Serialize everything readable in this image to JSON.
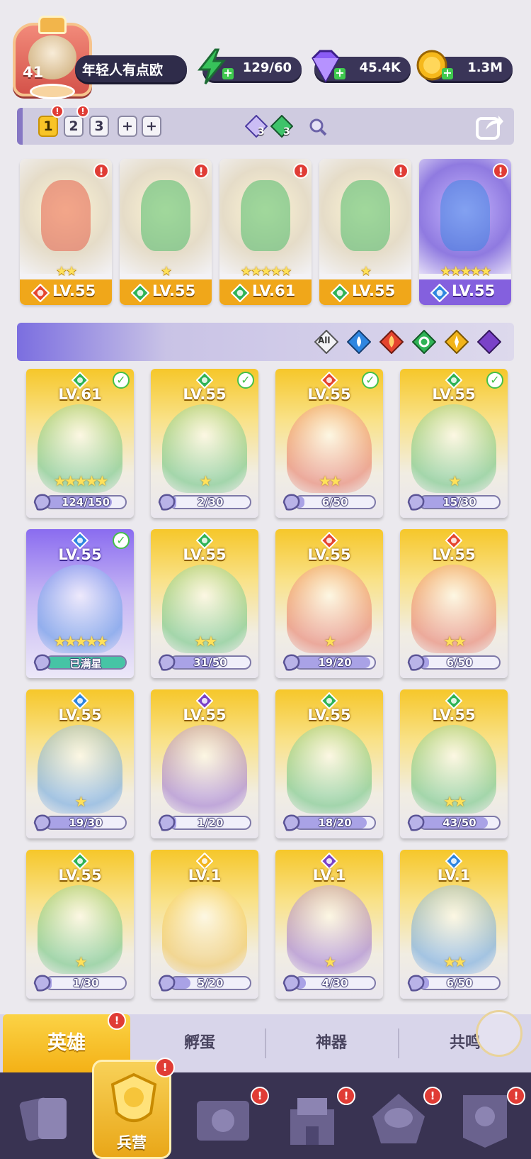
{
  "player": {
    "level": "41",
    "name": "年轻人有点欧",
    "avatar_icon": "player-avatar"
  },
  "resources": [
    {
      "name": "energy",
      "icon": "lightning-icon",
      "value": "129/60",
      "color": "#37c35a"
    },
    {
      "name": "gems",
      "icon": "diamond-icon",
      "value": "45.4K",
      "color": "#8b5cf6"
    },
    {
      "name": "gold",
      "icon": "coin-icon",
      "value": "1.3M",
      "color": "#f6b81b"
    }
  ],
  "teams": {
    "tabs": [
      "1",
      "2",
      "3",
      "+",
      "+"
    ],
    "active": "1",
    "runes": [
      {
        "icon": "purple-rune-icon",
        "count": "3"
      },
      {
        "icon": "green-rune-icon",
        "count": "3"
      }
    ],
    "search_icon": "magnifier-icon",
    "share_icon": "share-icon"
  },
  "lineup": [
    {
      "element": "fire",
      "level": "LV.55",
      "stars": "★★",
      "badge": "!",
      "theme": "gold"
    },
    {
      "element": "wind",
      "level": "LV.55",
      "stars": "★",
      "badge": "!",
      "theme": "gold"
    },
    {
      "element": "wind",
      "level": "LV.61",
      "stars": "★★★★★",
      "badge": "!",
      "theme": "gold"
    },
    {
      "element": "wind",
      "level": "LV.55",
      "stars": "★",
      "badge": "!",
      "theme": "gold"
    },
    {
      "element": "water",
      "level": "LV.55",
      "stars": "★★★★★",
      "badge": "!",
      "theme": "purple"
    }
  ],
  "filters": [
    "All",
    "water",
    "fire",
    "wind",
    "light",
    "dark"
  ],
  "filter_all_label": "All",
  "heroes": [
    {
      "element": "wind",
      "level": "LV.61",
      "stars": "★★★★★",
      "progress": "124/150",
      "fraction": 0.83,
      "ready": true,
      "theme": "gold"
    },
    {
      "element": "wind",
      "level": "LV.55",
      "stars": "★",
      "progress": "2/30",
      "fraction": 0.07,
      "ready": true,
      "theme": "gold"
    },
    {
      "element": "fire",
      "level": "LV.55",
      "stars": "★★",
      "progress": "6/50",
      "fraction": 0.12,
      "ready": true,
      "theme": "gold"
    },
    {
      "element": "wind",
      "level": "LV.55",
      "stars": "★",
      "progress": "15/30",
      "fraction": 0.5,
      "ready": true,
      "theme": "gold"
    },
    {
      "element": "water",
      "level": "LV.55",
      "stars": "★★★★★",
      "progress": "已满星",
      "fraction": 1,
      "ready": true,
      "theme": "purple"
    },
    {
      "element": "wind",
      "level": "LV.55",
      "stars": "★★",
      "progress": "31/50",
      "fraction": 0.62,
      "ready": false,
      "theme": "gold"
    },
    {
      "element": "fire",
      "level": "LV.55",
      "stars": "★",
      "progress": "19/20",
      "fraction": 0.95,
      "ready": false,
      "theme": "gold"
    },
    {
      "element": "fire",
      "level": "LV.55",
      "stars": "★★",
      "progress": "6/50",
      "fraction": 0.12,
      "ready": false,
      "theme": "gold"
    },
    {
      "element": "water",
      "level": "LV.55",
      "stars": "★",
      "progress": "19/30",
      "fraction": 0.63,
      "ready": false,
      "theme": "gold"
    },
    {
      "element": "dark",
      "level": "LV.55",
      "stars": "",
      "progress": "1/20",
      "fraction": 0.05,
      "ready": false,
      "theme": "gold"
    },
    {
      "element": "wind",
      "level": "LV.55",
      "stars": "",
      "progress": "18/20",
      "fraction": 0.9,
      "ready": false,
      "theme": "gold"
    },
    {
      "element": "wind",
      "level": "LV.55",
      "stars": "★★",
      "progress": "43/50",
      "fraction": 0.86,
      "ready": false,
      "theme": "gold"
    },
    {
      "element": "wind",
      "level": "LV.55",
      "stars": "★",
      "progress": "1/30",
      "fraction": 0.03,
      "ready": false,
      "theme": "gold"
    },
    {
      "element": "light",
      "level": "LV.1",
      "stars": "",
      "progress": "5/20",
      "fraction": 0.25,
      "ready": false,
      "theme": "gold"
    },
    {
      "element": "dark",
      "level": "LV.1",
      "stars": "★",
      "progress": "4/30",
      "fraction": 0.13,
      "ready": false,
      "theme": "gold"
    },
    {
      "element": "water",
      "level": "LV.1",
      "stars": "★★",
      "progress": "6/50",
      "fraction": 0.12,
      "ready": false,
      "theme": "gold"
    }
  ],
  "tabs": [
    {
      "label": "英雄",
      "active": true,
      "badge": "!"
    },
    {
      "label": "孵蛋",
      "active": false
    },
    {
      "label": "神器",
      "active": false
    },
    {
      "label": "共鸣",
      "active": false
    }
  ],
  "nav": [
    {
      "icon": "cards-icon",
      "label": "",
      "badge": ""
    },
    {
      "icon": "barracks-icon",
      "label": "兵营",
      "badge": "!",
      "active": true
    },
    {
      "icon": "map-book-icon",
      "label": "",
      "badge": "!"
    },
    {
      "icon": "castle-icon",
      "label": "",
      "badge": "!"
    },
    {
      "icon": "mushroom-house-icon",
      "label": "",
      "badge": "!"
    },
    {
      "icon": "guild-banner-icon",
      "label": "",
      "badge": "!"
    }
  ],
  "element_colors": {
    "fire": "#e5452e",
    "wind": "#2fb356",
    "water": "#2f86e0",
    "light": "#f2b41a",
    "dark": "#7a42c8"
  }
}
